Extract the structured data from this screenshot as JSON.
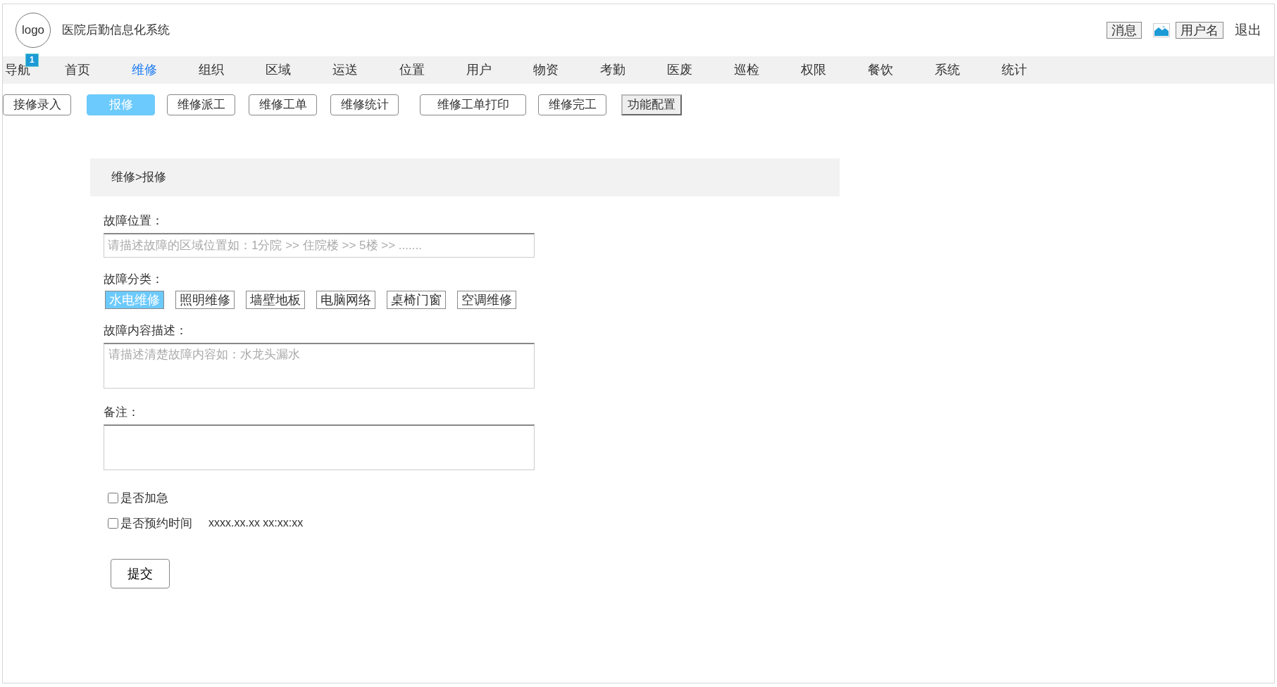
{
  "header": {
    "logo": "logo",
    "title": "医院后勤信息化系统",
    "messages": "消息",
    "username": "用户名",
    "logout": "退出"
  },
  "nav": {
    "label": "导航",
    "badge": "1",
    "items": [
      {
        "label": "首页",
        "selected": false
      },
      {
        "label": "维修",
        "selected": true
      },
      {
        "label": "组织",
        "selected": false
      },
      {
        "label": "区域",
        "selected": false
      },
      {
        "label": "运送",
        "selected": false
      },
      {
        "label": "位置",
        "selected": false
      },
      {
        "label": "用户",
        "selected": false
      },
      {
        "label": "物资",
        "selected": false
      },
      {
        "label": "考勤",
        "selected": false
      },
      {
        "label": "医废",
        "selected": false
      },
      {
        "label": "巡检",
        "selected": false
      },
      {
        "label": "权限",
        "selected": false
      },
      {
        "label": "餐饮",
        "selected": false
      },
      {
        "label": "系统",
        "selected": false
      },
      {
        "label": "统计",
        "selected": false
      }
    ]
  },
  "subtabs": [
    {
      "label": "接修录入",
      "kind": "tab",
      "selected": false
    },
    {
      "label": "报修",
      "kind": "tab",
      "selected": true
    },
    {
      "label": "维修派工",
      "kind": "tab",
      "selected": false
    },
    {
      "label": "维修工单",
      "kind": "tab",
      "selected": false
    },
    {
      "label": "维修统计",
      "kind": "tab",
      "selected": false
    },
    {
      "label": "维修工单打印",
      "kind": "wide",
      "selected": false
    },
    {
      "label": "维修完工",
      "kind": "tab",
      "selected": false
    },
    {
      "label": "功能配置",
      "kind": "config",
      "selected": false
    }
  ],
  "breadcrumb": "维修>报修",
  "form": {
    "location": {
      "label": "故障位置：",
      "placeholder": "请描述故障的区域位置如：1分院 >> 住院楼 >> 5楼 >> ......."
    },
    "category": {
      "label": "故障分类：",
      "options": [
        {
          "label": "水电维修",
          "selected": true
        },
        {
          "label": "照明维修",
          "selected": false
        },
        {
          "label": "墙壁地板",
          "selected": false
        },
        {
          "label": "电脑网络",
          "selected": false
        },
        {
          "label": "桌椅门窗",
          "selected": false
        },
        {
          "label": "空调维修",
          "selected": false
        }
      ]
    },
    "description": {
      "label": "故障内容描述：",
      "placeholder": "请描述清楚故障内容如：水龙头漏水"
    },
    "remarks": {
      "label": "备注："
    },
    "checks": [
      {
        "label": "是否加急",
        "checked": false
      },
      {
        "label": "是否预约时间",
        "checked": false,
        "value": "xxxx.xx.xx xx:xx:xx"
      }
    ],
    "submit": "提交"
  }
}
